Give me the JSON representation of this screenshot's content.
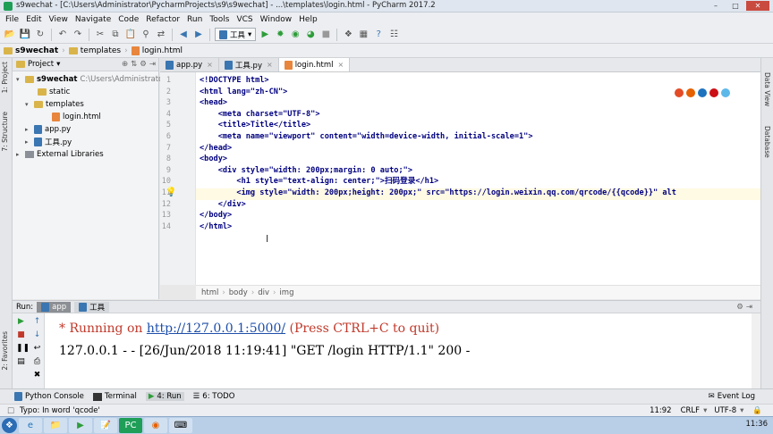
{
  "window": {
    "title": "s9wechat - [C:\\Users\\Administrator\\PycharmProjects\\s9\\s9wechat] - ...\\templates\\login.html - PyCharm 2017.2",
    "controls": [
      "minimize",
      "maximize",
      "close"
    ]
  },
  "menu": [
    "File",
    "Edit",
    "View",
    "Navigate",
    "Code",
    "Refactor",
    "Run",
    "Tools",
    "VCS",
    "Window",
    "Help"
  ],
  "toolbar": {
    "run_config": "工具",
    "icons": [
      "save-icon",
      "sync-icon",
      "undo-icon",
      "redo-icon",
      "cut-icon",
      "copy-icon",
      "paste-icon",
      "find-icon",
      "replace-icon",
      "back-icon",
      "forward-icon",
      "run-icon",
      "debug-icon",
      "coverage-icon",
      "profile-icon",
      "stop-icon",
      "settings-icon",
      "help-icon",
      "structure-icon"
    ]
  },
  "navbar": {
    "items": [
      "s9wechat",
      "templates",
      "login.html"
    ]
  },
  "left_strip": {
    "labels": [
      "1: Project",
      "7: Structure",
      "2: Favorites"
    ]
  },
  "right_strip": {
    "labels": [
      "Data View",
      "Database"
    ]
  },
  "project": {
    "header": "Project",
    "tree": [
      {
        "label": "s9wechat",
        "hint": "C:\\Users\\Administrator",
        "type": "folder",
        "level": 0,
        "expanded": true
      },
      {
        "label": "static",
        "type": "folder",
        "level": 1
      },
      {
        "label": "templates",
        "type": "folder",
        "level": 1,
        "expanded": true
      },
      {
        "label": "login.html",
        "type": "html",
        "level": 2
      },
      {
        "label": "app.py",
        "type": "py",
        "level": 1
      },
      {
        "label": "工具.py",
        "type": "py",
        "level": 1
      },
      {
        "label": "External Libraries",
        "type": "lib",
        "level": 0
      }
    ]
  },
  "editor": {
    "tabs": [
      {
        "label": "app.py",
        "type": "py"
      },
      {
        "label": "工具.py",
        "type": "py"
      },
      {
        "label": "login.html",
        "type": "html",
        "active": true
      }
    ],
    "line_numbers": [
      "1",
      "2",
      "3",
      "4",
      "5",
      "6",
      "7",
      "8",
      "9",
      "10",
      "11",
      "12",
      "13",
      "14"
    ],
    "code": [
      "<!DOCTYPE html>",
      "<html lang=\"zh-CN\">",
      "<head>",
      "    <meta charset=\"UTF-8\">",
      "    <title>Title</title>",
      "    <meta name=\"viewport\" content=\"width=device-width, initial-scale=1\">",
      "</head>",
      "<body>",
      "    <div style=\"width: 200px;margin: 0 auto;\">",
      "        <h1 style=\"text-align: center;\">扫码登录</h1>",
      "        <img style=\"width: 200px;height: 200px;\" src=\"https://login.weixin.qq.com/qrcode/{{qcode}}\" alt",
      "    </div>",
      "</body>",
      "</html>"
    ],
    "breadcrumbs": [
      "html",
      "body",
      "div",
      "img"
    ]
  },
  "run": {
    "label": "Run:",
    "tabs": [
      {
        "label": "app",
        "active": true
      },
      {
        "label": "工具",
        "active": false
      }
    ],
    "console": [
      {
        " text_prefix": " * Running on ",
        "link": "http://127.0.0.1:5000/",
        "suffix": " (Press CTRL+C to quit)"
      },
      {
        "text": "127.0.0.1 - - [26/Jun/2018 11:19:41] \"GET /login HTTP/1.1\" 200 -"
      }
    ]
  },
  "bottom_tools": [
    "Python Console",
    "Terminal",
    "4: Run",
    "6: TODO"
  ],
  "event_log": "Event Log",
  "status": {
    "message": "Typo: In word 'qcode'",
    "position": "11:92",
    "line_sep": "CRLF",
    "encoding": "UTF-8"
  },
  "taskbar": {
    "time": "11:36",
    "apps": [
      "start",
      "ie",
      "explorer",
      "media",
      "notepad",
      "pycharm",
      "browser",
      "terminal"
    ]
  }
}
